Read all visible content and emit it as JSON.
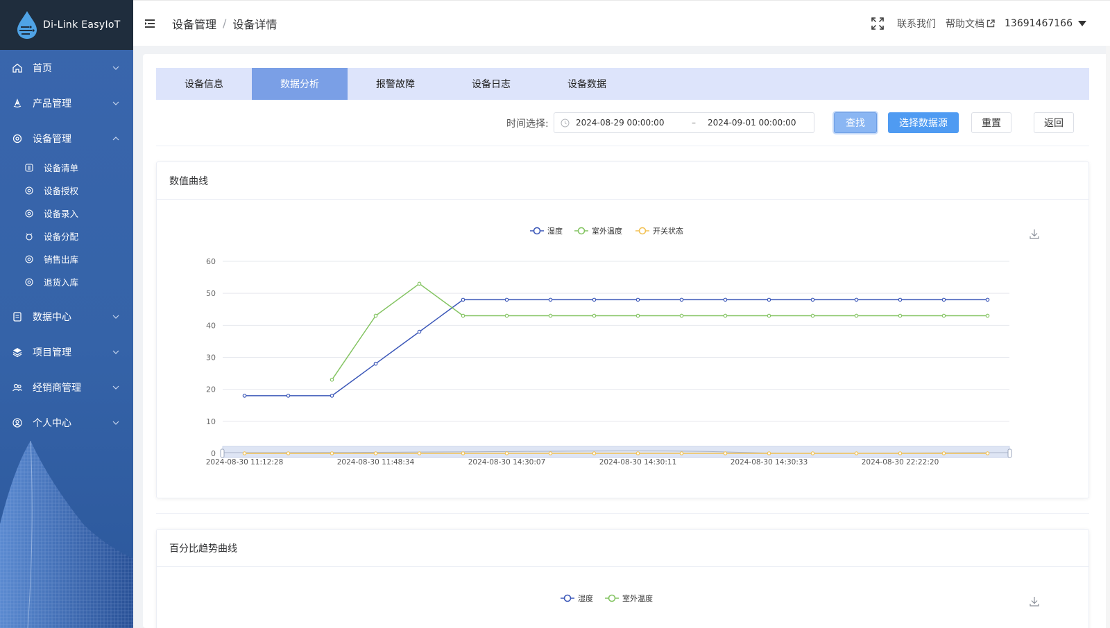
{
  "app": {
    "name": "Di-Link EasyIoT"
  },
  "sidebar": {
    "items": [
      {
        "label": "首页",
        "icon": "home-icon",
        "expanded": false
      },
      {
        "label": "产品管理",
        "icon": "product-icon",
        "expanded": false
      },
      {
        "label": "设备管理",
        "icon": "device-icon",
        "expanded": true,
        "children": [
          {
            "label": "设备清单",
            "icon": "list-icon"
          },
          {
            "label": "设备授权",
            "icon": "authorize-icon"
          },
          {
            "label": "设备录入",
            "icon": "input-icon"
          },
          {
            "label": "设备分配",
            "icon": "assign-icon"
          },
          {
            "label": "销售出库",
            "icon": "outbound-icon"
          },
          {
            "label": "退货入库",
            "icon": "inbound-icon"
          }
        ]
      },
      {
        "label": "数据中心",
        "icon": "data-center-icon",
        "expanded": false
      },
      {
        "label": "项目管理",
        "icon": "project-icon",
        "expanded": false
      },
      {
        "label": "经销商管理",
        "icon": "dealer-icon",
        "expanded": false
      },
      {
        "label": "个人中心",
        "icon": "user-center-icon",
        "expanded": false
      }
    ]
  },
  "header": {
    "breadcrumb": [
      "设备管理",
      "设备详情"
    ],
    "contact": "联系我们",
    "help": "帮助文档",
    "user": "13691467166"
  },
  "tabs": [
    {
      "label": "设备信息",
      "active": false
    },
    {
      "label": "数据分析",
      "active": true
    },
    {
      "label": "报警故障",
      "active": false
    },
    {
      "label": "设备日志",
      "active": false
    },
    {
      "label": "设备数据",
      "active": false
    }
  ],
  "toolbar": {
    "time_label": "时间选择:",
    "start": "2024-08-29 00:00:00",
    "separator": "–",
    "end": "2024-09-01 00:00:00",
    "search": "查找",
    "select_source": "选择数据源",
    "reset": "重置",
    "back": "返回"
  },
  "colors": {
    "accent": "#4f9bf2",
    "humidity": "#3b57b8",
    "outdoor_temp": "#84c462",
    "switch_state": "#f2c153",
    "sidebar": "#3563a8"
  },
  "chart_data": [
    {
      "type": "line",
      "title": "数值曲线",
      "x": [
        "2024-08-30 11:12:28",
        "",
        "",
        "2024-08-30 11:48:34",
        "",
        "",
        "2024-08-30 14:30:07",
        "",
        "",
        "2024-08-30 14:30:11",
        "",
        "",
        "2024-08-30 14:30:33",
        "",
        "",
        "2024-08-30 22:22:20",
        "",
        ""
      ],
      "x_tick_labels": [
        "2024-08-30 11:12:28",
        "2024-08-30 11:48:34",
        "2024-08-30 14:30:07",
        "2024-08-30 14:30:11",
        "2024-08-30 14:30:33",
        "2024-08-30 22:22:20"
      ],
      "series": [
        {
          "name": "湿度",
          "values": [
            18,
            18,
            18,
            28,
            38,
            48,
            48,
            48,
            48,
            48,
            48,
            48,
            48,
            48,
            48,
            48,
            48,
            48
          ]
        },
        {
          "name": "室外温度",
          "values": [
            null,
            null,
            23,
            43,
            53,
            43,
            43,
            43,
            43,
            43,
            43,
            43,
            43,
            43,
            43,
            43,
            43,
            43
          ]
        },
        {
          "name": "开关状态",
          "values": [
            0,
            0,
            0,
            0,
            0,
            0,
            0,
            0,
            0,
            0,
            0,
            0,
            0,
            0,
            0,
            0,
            0,
            0
          ]
        }
      ],
      "ylim": [
        0,
        60
      ],
      "yticks": [
        0,
        10,
        20,
        30,
        40,
        50,
        60
      ],
      "grid": true,
      "legend": "top-center",
      "datazoom": true
    },
    {
      "type": "line",
      "title": "百分比趋势曲线",
      "series": [
        {
          "name": "湿度"
        },
        {
          "name": "室外温度"
        }
      ],
      "legend": "top-center"
    }
  ]
}
